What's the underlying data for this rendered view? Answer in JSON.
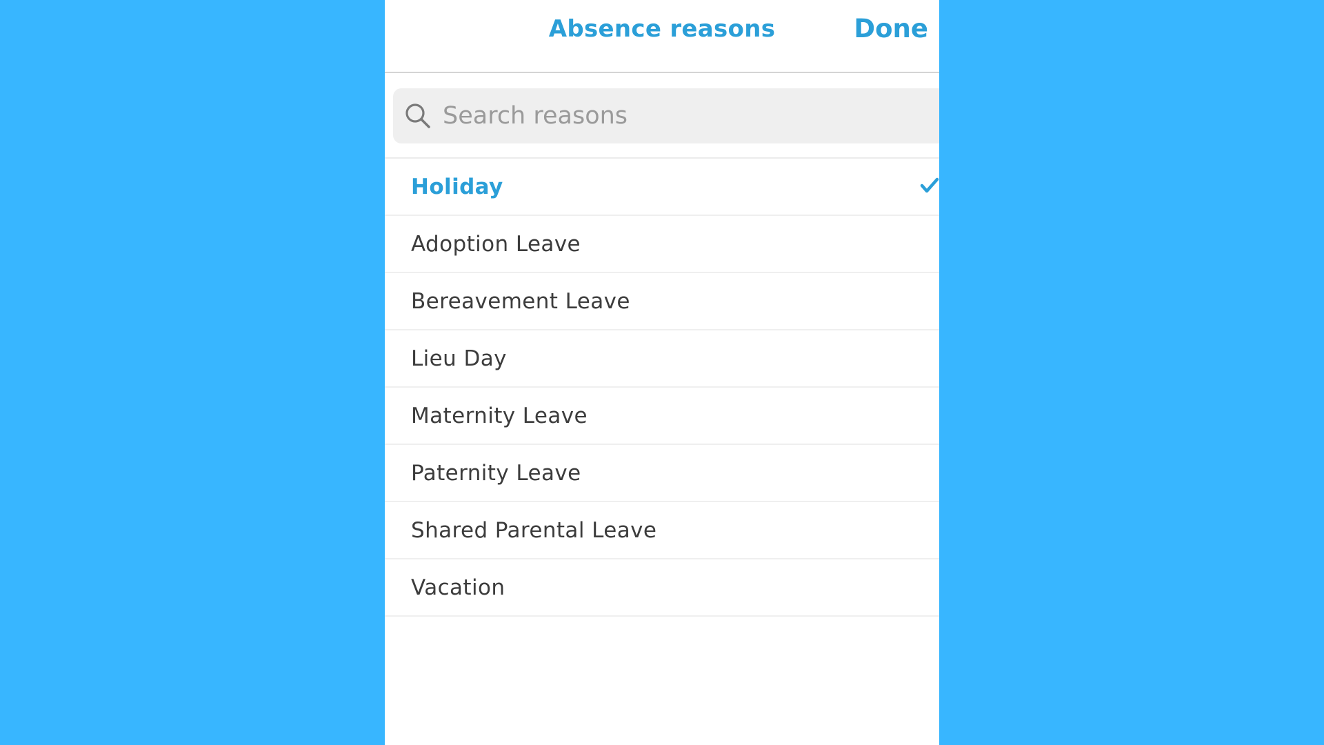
{
  "header": {
    "title": "Absence reasons",
    "done_label": "Done"
  },
  "search": {
    "placeholder": "Search reasons",
    "value": "",
    "icon": "search-icon"
  },
  "reasons": [
    {
      "label": "Holiday",
      "selected": true
    },
    {
      "label": "Adoption Leave",
      "selected": false
    },
    {
      "label": "Bereavement Leave",
      "selected": false
    },
    {
      "label": "Lieu Day",
      "selected": false
    },
    {
      "label": "Maternity Leave",
      "selected": false
    },
    {
      "label": "Paternity Leave",
      "selected": false
    },
    {
      "label": "Shared Parental Leave",
      "selected": false
    },
    {
      "label": "Vacation",
      "selected": false
    }
  ],
  "colors": {
    "background": "#38b6ff",
    "accent": "#2b9fd8",
    "text": "#3c3c3c",
    "search_bg": "#efefef"
  }
}
